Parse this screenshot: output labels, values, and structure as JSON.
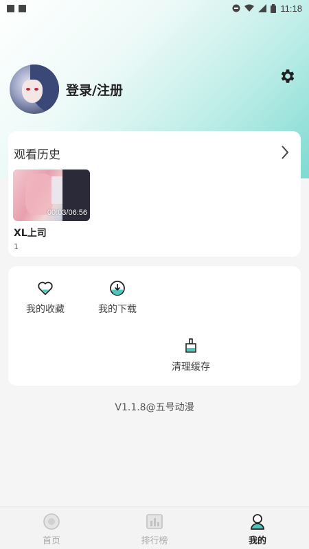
{
  "status_bar": {
    "time": "11:18"
  },
  "profile": {
    "login_label": "登录/注册"
  },
  "history": {
    "title": "观看历史",
    "items": [
      {
        "title": "XL上司",
        "episode": "1",
        "progress": "00:03/06:56"
      }
    ]
  },
  "actions": [
    {
      "label": "我的收藏",
      "icon": "heart-icon"
    },
    {
      "label": "我的下载",
      "icon": "download-icon"
    },
    {
      "label": "清理缓存",
      "icon": "broom-icon"
    }
  ],
  "version": "V1.1.8@五号动漫",
  "tabs": [
    {
      "label": "首页",
      "icon": "home-icon",
      "active": false
    },
    {
      "label": "排行榜",
      "icon": "ranking-icon",
      "active": false
    },
    {
      "label": "我的",
      "icon": "profile-icon",
      "active": true
    }
  ],
  "colors": {
    "accent": "#4cc7bd",
    "gradient_end": "#7fd9d2"
  }
}
